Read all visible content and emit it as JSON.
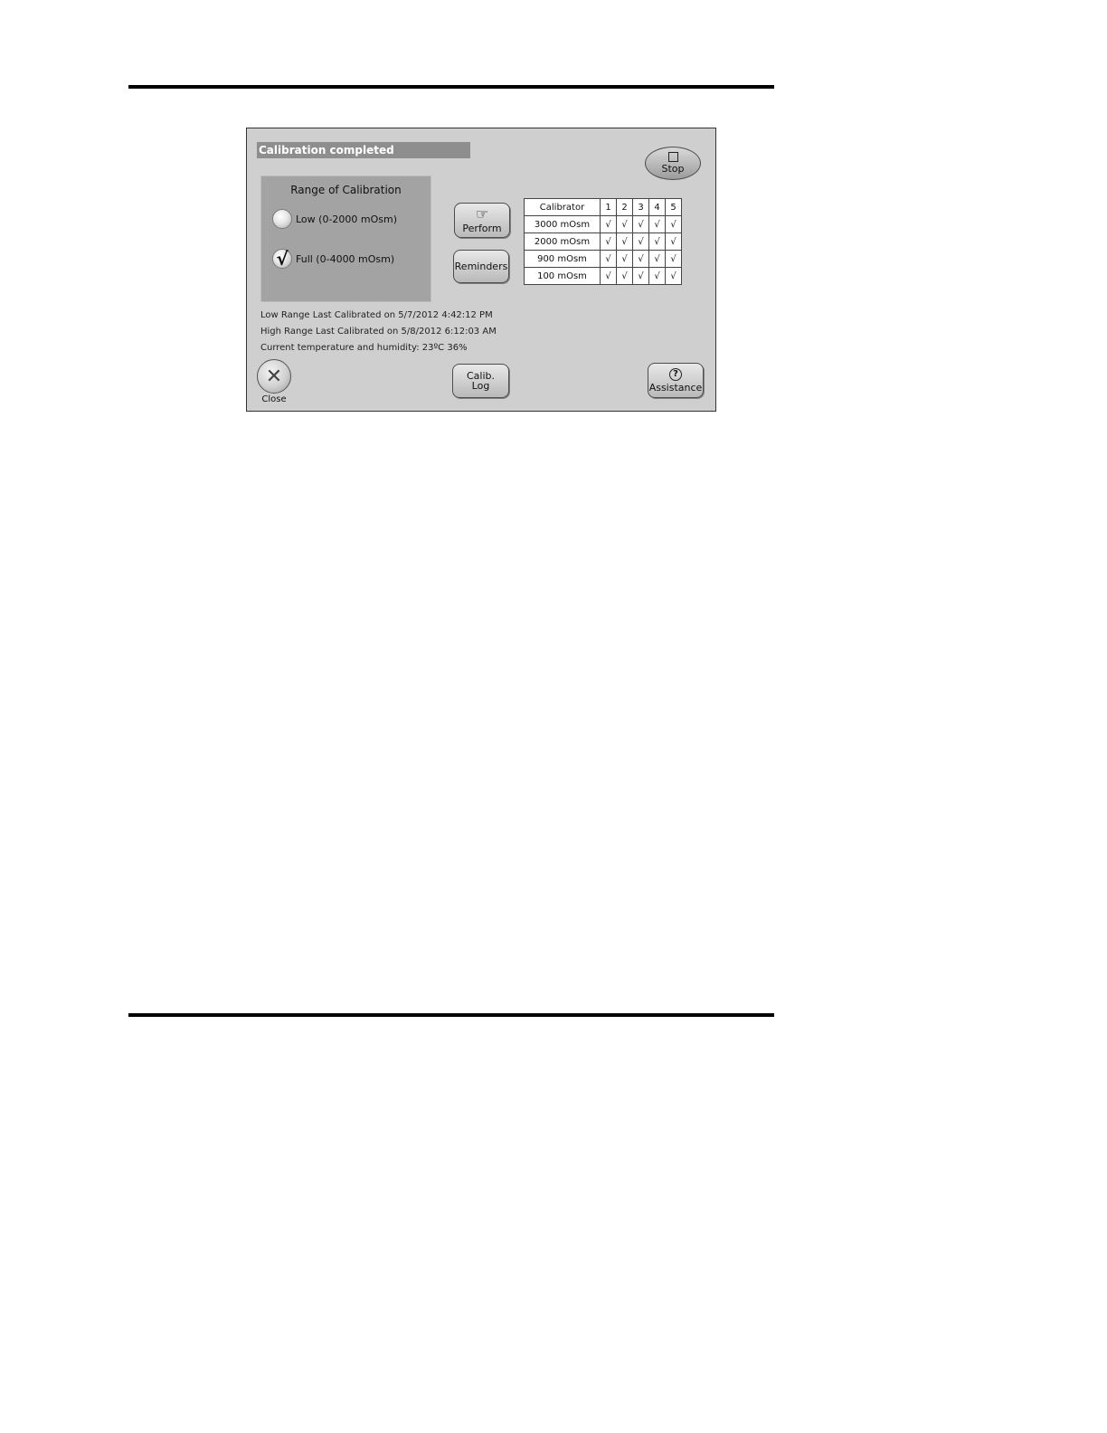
{
  "window": {
    "title": "Calibration completed"
  },
  "stop_button": {
    "label": "Stop",
    "icon": "stop-square-icon"
  },
  "range_panel": {
    "title": "Range of Calibration",
    "options": [
      {
        "label": "Low (0-2000 mOsm)",
        "selected": false
      },
      {
        "label": "Full (0-4000 mOsm)",
        "selected": true,
        "mark": "√"
      }
    ]
  },
  "buttons": {
    "perform": "Perform",
    "reminders": "Reminders",
    "calib_log_line1": "Calib.",
    "calib_log_line2": "Log",
    "assistance": "Assistance",
    "close": "Close"
  },
  "icons": {
    "perform": "☞",
    "assistance": "?",
    "close": "✕"
  },
  "calibrator_table": {
    "header": [
      "Calibrator",
      "1",
      "2",
      "3",
      "4",
      "5"
    ],
    "rows": [
      {
        "name": "3000 mOsm",
        "checks": [
          "√",
          "√",
          "√",
          "√",
          "√"
        ]
      },
      {
        "name": "2000 mOsm",
        "checks": [
          "√",
          "√",
          "√",
          "√",
          "√"
        ]
      },
      {
        "name": "900 mOsm",
        "checks": [
          "√",
          "√",
          "√",
          "√",
          "√"
        ]
      },
      {
        "name": "100 mOsm",
        "checks": [
          "√",
          "√",
          "√",
          "√",
          "√"
        ]
      }
    ]
  },
  "info": {
    "low_range": "Low Range Last Calibrated on 5/7/2012 4:42:12 PM",
    "high_range": "High Range Last Calibrated on 5/8/2012 6:12:03 AM",
    "temperature_humidity": "Current temperature and humidity:  23ºC   36%"
  }
}
